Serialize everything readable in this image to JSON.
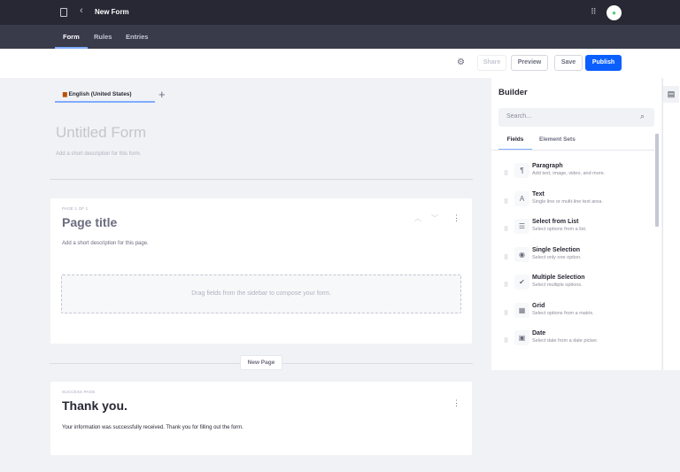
{
  "header": {
    "title": "New Form",
    "back_icon": "chevron-left-icon",
    "panel_icon": "sidebar-icon",
    "apps_icon": "grid-icon",
    "avatar_icon": "user-icon"
  },
  "nav": {
    "tabs": [
      {
        "label": "Form",
        "active": true
      },
      {
        "label": "Rules"
      },
      {
        "label": "Entries"
      }
    ]
  },
  "toolbar": {
    "settings_icon": "gear-icon",
    "share": "Share",
    "preview": "Preview",
    "save": "Save",
    "publish": "Publish",
    "accent": "#0b5fff"
  },
  "language": {
    "label": "English (United States)",
    "add": "+"
  },
  "form": {
    "title_placeholder": "Untitled Form",
    "description_placeholder": "Add a short description for this form."
  },
  "page": {
    "counter": "Page 1 of 1",
    "title": "Page title",
    "description": "Add a short description for this page.",
    "dropzone": "Drag fields from the sidebar to compose your form."
  },
  "new_page": "New Page",
  "success": {
    "label": "Success Page",
    "title": "Thank you.",
    "body": "Your information was successfully received. Thank you for filling out the form."
  },
  "builder": {
    "title": "Builder",
    "search_placeholder": "Search...",
    "tabs": [
      "Fields",
      "Element Sets"
    ],
    "fields": [
      {
        "title": "Paragraph",
        "desc": "Add text, image, video, and more.",
        "icon": "paragraph-icon",
        "glyph": "¶"
      },
      {
        "title": "Text",
        "desc": "Single line or multi-line text area.",
        "icon": "text-icon",
        "glyph": "A"
      },
      {
        "title": "Select from List",
        "desc": "Select options from a list.",
        "icon": "list-icon",
        "glyph": "☰"
      },
      {
        "title": "Single Selection",
        "desc": "Select only one option.",
        "icon": "radio-icon",
        "glyph": "◉"
      },
      {
        "title": "Multiple Selection",
        "desc": "Select multiple options.",
        "icon": "checkbox-icon",
        "glyph": "✔"
      },
      {
        "title": "Grid",
        "desc": "Select options from a matrix.",
        "icon": "grid-table-icon",
        "glyph": "▦"
      },
      {
        "title": "Date",
        "desc": "Select date from a date picker.",
        "icon": "calendar-icon",
        "glyph": "▣"
      }
    ]
  }
}
